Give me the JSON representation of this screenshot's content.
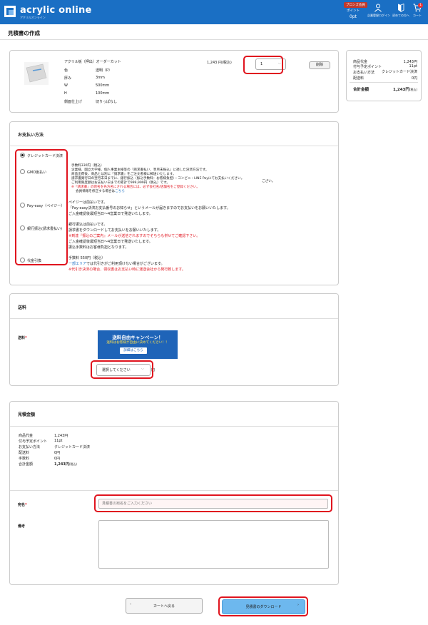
{
  "header": {
    "logo_text": "acrylic online",
    "logo_sub": "アクリルオンライン",
    "member_badge": "ブロンズ会員",
    "points_label": "ポイント",
    "points_value": "0pt",
    "nav": [
      {
        "label": "企業登録ログイン",
        "icon": "user-icon"
      },
      {
        "label": "初めての方へ",
        "icon": "beginner-icon"
      },
      {
        "label": "カート",
        "icon": "cart-icon"
      }
    ],
    "cart_count": "1",
    "colors": {
      "bar": "#1a6fc4",
      "accent_red": "#e0141e"
    }
  },
  "page_title": "見積書の作成",
  "product": {
    "name": "アクリル板（押出）オーダーカット",
    "specs": [
      {
        "k": "色",
        "v": "透明（P）"
      },
      {
        "k": "厚み",
        "v": "3mm"
      },
      {
        "k": "W",
        "v": "500mm"
      },
      {
        "k": "H",
        "v": "100mm"
      },
      {
        "k": "側面仕上げ",
        "v": "切りっぱなし"
      }
    ],
    "price": "1,243 円(税込)",
    "quantity": "1",
    "delete_label": "削除"
  },
  "sidebar": {
    "rows": [
      {
        "k": "商品代金",
        "v": "1,243円"
      },
      {
        "k": "付与予定ポイント",
        "v": "11pt"
      },
      {
        "k": "お支払い方法",
        "v": "クレジットカード決済"
      },
      {
        "k": "配送料",
        "v": "0円"
      }
    ],
    "total_label": "合計金額",
    "total_value": "1,243円",
    "total_tax": "(税込)"
  },
  "payment": {
    "title": "お支払い方法",
    "options": [
      {
        "label": "クレジットカード決済",
        "selected": true
      },
      {
        "label": "GMO後払い",
        "selected": false
      },
      {
        "label": "Pay-easy（ペイジー）",
        "selected": false
      },
      {
        "label": "銀行振込(請求書払い)",
        "selected": false
      },
      {
        "label": "代金引換",
        "selected": false
      }
    ],
    "gmo_lines": [
      "手数料330円（税込）",
      "企業様、国立大学様、個人事業主様等の『請求書払い、翌月末振込』に適した決済方法です。",
      "商品出荷後、商品とは別に『請求書』をご注文者様に郵送いたします。",
      "請求書発行日の翌月末日までに、銀行振込（振込手数料：お客様負担）・コンビニ・LINE Payにてお支払いください。",
      "ご利用限度額はお支払い日までの累計で999,999円（税込）です。",
      "※『請求書』の宛名を先方名にされる場合には、必ず会社名/店舗名をご登録ください。",
      "会員情報を修正する場合は",
      "こちら",
      "ござい。"
    ],
    "payeasy_lines": [
      "ペイジーは前払いです。",
      "「Pay-easy決済お支払番号のお知らせ」というメールが届きますのでお支払いをお願いいたします。",
      "ご入金確認後最短当日〜4営業日で発送いたします。"
    ],
    "bank_lines": [
      "銀行振込は前払いです。",
      "請求書をダウンロードしてお支払いをお願いいたします。",
      "※到達『振込のご案内』メールが送信されますのでそちらも併せてご確認下さい。",
      "ご入金確認後最短当日〜4営業日で発送いたします。",
      "振込手数料はお客様負担となります。"
    ],
    "cod_lines": [
      "手数料 550円（税込）",
      "一部エリア",
      "では代引きがご利用頂けない場合がございます。",
      "※代引き決済の場合、領収書はお支払い時に運送会社から発行致します。"
    ]
  },
  "shipping": {
    "title": "送料",
    "label": "送料",
    "required_mark": "*",
    "banner_title": "送料自由キャンペーン！",
    "banner_text": "送料はお客様が自由に決めてください！！",
    "banner_button": "詳細はこちら",
    "select_placeholder": "選択してください",
    "unit": "円"
  },
  "estimate": {
    "title": "見積金額",
    "rows": [
      {
        "k": "商品代金",
        "v": "1,243円"
      },
      {
        "k": "付与予定ポイント",
        "v": "11pt"
      },
      {
        "k": "お支払い方法",
        "v": "クレジットカード決済"
      },
      {
        "k": "配送料",
        "v": "0円"
      },
      {
        "k": "手数料",
        "v": "0円"
      },
      {
        "k": "合計金額",
        "v": "1,243円",
        "tax": "(税込)"
      }
    ],
    "addressee_label": "宛名",
    "required_mark": "*",
    "addressee_placeholder": "見積書の宛名をご入力ください",
    "remarks_label": "備考",
    "remarks_value": ""
  },
  "buttons": {
    "back_label": "カートへ戻る",
    "download_label": "見積書のダウンロード"
  }
}
